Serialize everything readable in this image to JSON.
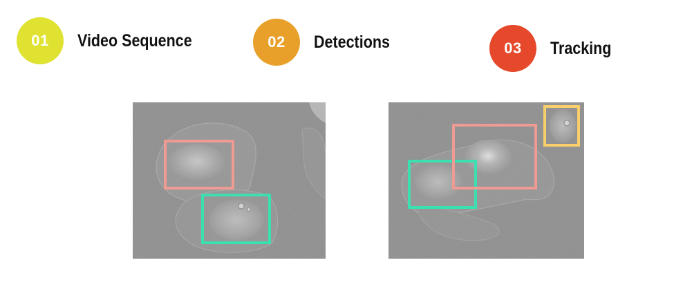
{
  "steps": [
    {
      "number": "01",
      "label": "Video Sequence",
      "color": "#dfe231"
    },
    {
      "number": "02",
      "label": "Detections",
      "color": "#e8a02a"
    },
    {
      "number": "03",
      "label": "Tracking",
      "color": "#e5482a"
    }
  ],
  "box_colors": {
    "pink": "#ef9a92",
    "teal": "#3be0b0",
    "yellow": "#f8cf6a"
  },
  "microscopy_background": "#8a8a8a"
}
